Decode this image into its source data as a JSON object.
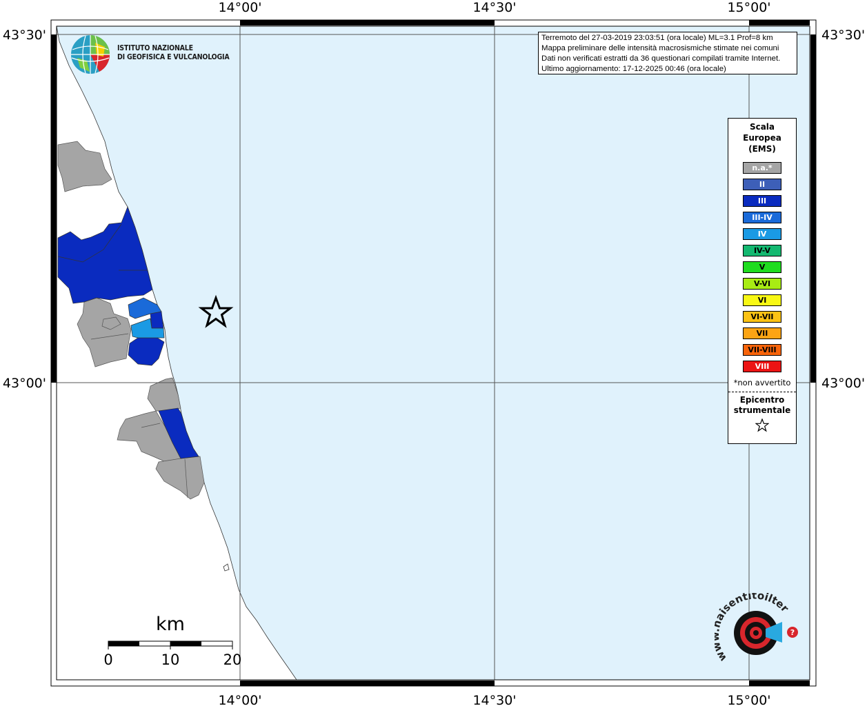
{
  "map": {
    "lat_labels": [
      "43°30'",
      "43°00'"
    ],
    "lon_labels": [
      "14°00'",
      "14°30'",
      "15°00'"
    ],
    "colors": {
      "sea": "#e0f2fc",
      "land": "#ffffff",
      "no_data": "#a5a5a5",
      "intensity_III": "#0a2bbf",
      "intensity_IV": "#1a9ae4",
      "intensity_III_IV": "#1a6ad9"
    }
  },
  "institute": {
    "line1": "ISTITUTO NAZIONALE",
    "line2": "DI GEOFISICA E VULCANOLOGIA"
  },
  "info": {
    "line1": "Terremoto del 27-03-2019 23:03:51 (ora locale) ML=3.1 Prof=8 km",
    "line2": "Mappa preliminare delle intensità macrosismiche stimate nei comuni",
    "line3": "Dati non verificati estratti da 36 questionari compilati tramite Internet.",
    "line4": "Ultimo aggiornamento: 17-12-2025 00:46 (ora locale)"
  },
  "legend": {
    "title1": "Scala",
    "title2": "Europea",
    "title3": "(EMS)",
    "items": [
      {
        "label": "n.a.*",
        "color": "#a5a5a5"
      },
      {
        "label": "II",
        "color": "#3d5fb8"
      },
      {
        "label": "III",
        "color": "#0a2bbf"
      },
      {
        "label": "III-IV",
        "color": "#1a6ad9"
      },
      {
        "label": "IV",
        "color": "#1a9ae4"
      },
      {
        "label": "IV-V",
        "color": "#14b870"
      },
      {
        "label": "V",
        "color": "#1fdc1f"
      },
      {
        "label": "V-VI",
        "color": "#a8ec14"
      },
      {
        "label": "VI",
        "color": "#f8f814"
      },
      {
        "label": "VI-VII",
        "color": "#fcc214"
      },
      {
        "label": "VII",
        "color": "#fca414"
      },
      {
        "label": "VII-VIII",
        "color": "#f8640a"
      },
      {
        "label": "VIII",
        "color": "#ec1414"
      }
    ],
    "note": "*non avvertito",
    "epi1": "Epicentro",
    "epi2": "strumentale"
  },
  "scale": {
    "unit": "km",
    "ticks": [
      "0",
      "10",
      "20"
    ]
  },
  "logo2": {
    "text": "www.haisentitoilterremoto.it"
  }
}
